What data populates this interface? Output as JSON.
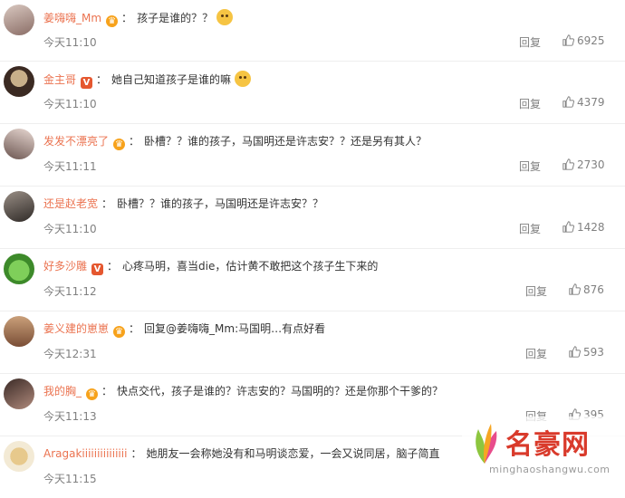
{
  "comments": [
    {
      "user": "姜嗨嗨_Mm",
      "badge": "crown",
      "text": "孩子是谁的？？",
      "emoji": "dog-emoji",
      "time": "今天11:10",
      "reply": "回复",
      "likes": "6925"
    },
    {
      "user": "金主哥",
      "badge": "v",
      "text": "她自己知道孩子是谁的嘛",
      "emoji": "thinking-emoji",
      "time": "今天11:10",
      "reply": "回复",
      "likes": "4379"
    },
    {
      "user": "发发不漂亮了",
      "badge": "crown",
      "text": "卧槽？？谁的孩子，马国明还是许志安？？还是另有其人？",
      "emoji": "",
      "time": "今天11:11",
      "reply": "回复",
      "likes": "2730"
    },
    {
      "user": "还是赵老宽",
      "badge": "",
      "text": "卧槽？？谁的孩子，马国明还是许志安？？",
      "emoji": "",
      "time": "今天11:10",
      "reply": "回复",
      "likes": "1428"
    },
    {
      "user": "好多沙雕",
      "badge": "v",
      "text": "心疼马明，喜当die，估计黄不敢把这个孩子生下来的",
      "emoji": "",
      "time": "今天11:12",
      "reply": "回复",
      "likes": "876"
    },
    {
      "user": "姜义建的崽崽",
      "badge": "crown",
      "text": "回复@姜嗨嗨_Mm:马国明…有点好看",
      "emoji": "",
      "time": "今天12:31",
      "reply": "回复",
      "likes": "593"
    },
    {
      "user": "我的胸_",
      "badge": "crown",
      "text": "快点交代，孩子是谁的？许志安的？马国明的？还是你那个干爹的？",
      "emoji": "",
      "time": "今天11:13",
      "reply": "回复",
      "likes": "395"
    },
    {
      "user": "Aragakiiiiiiiiiiiiiii",
      "badge": "",
      "text": "她朋友一会称她没有和马明谈恋爱，一会又说同居，脑子简直",
      "emoji": "",
      "time": "今天11:15",
      "reply": "",
      "likes": ""
    }
  ],
  "watermark": {
    "brand": "名豪网",
    "url": "minghaoshangwu.com"
  },
  "colors": {
    "username": "#eb7350",
    "meta": "#808080",
    "text": "#333333",
    "divider": "#eeeeee"
  }
}
